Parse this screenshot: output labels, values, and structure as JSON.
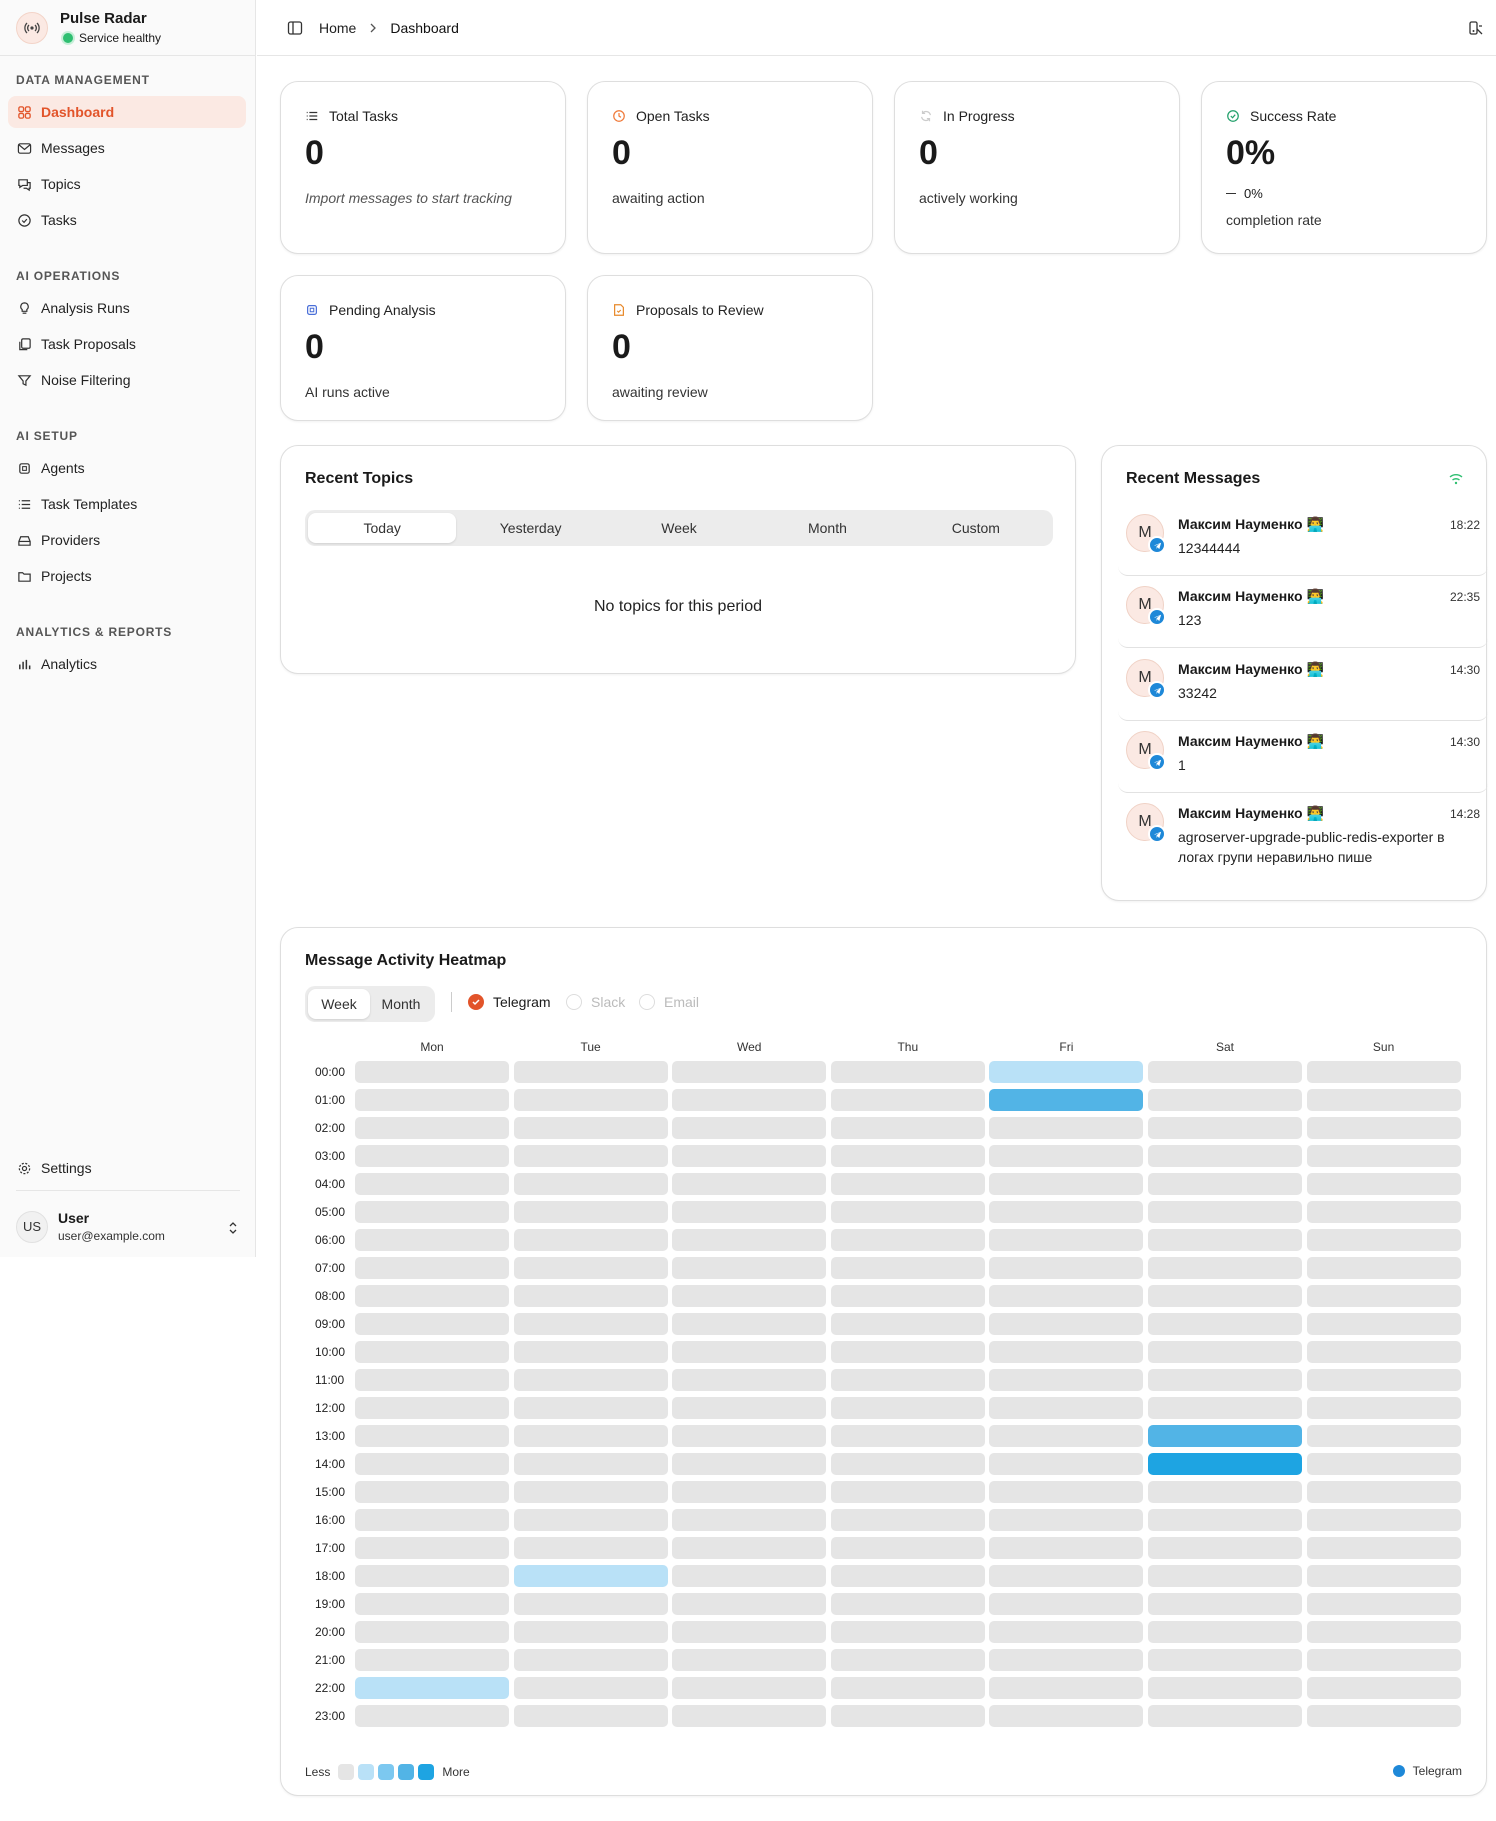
{
  "brand": {
    "name": "Pulse Radar",
    "status": "Service healthy"
  },
  "sidebar": {
    "sections": [
      {
        "label": "DATA MANAGEMENT",
        "items": [
          {
            "label": "Dashboard",
            "icon": "grid-icon"
          },
          {
            "label": "Messages",
            "icon": "mail-icon"
          },
          {
            "label": "Topics",
            "icon": "chat-icon"
          },
          {
            "label": "Tasks",
            "icon": "check-circle-icon"
          }
        ]
      },
      {
        "label": "AI OPERATIONS",
        "items": [
          {
            "label": "Analysis Runs",
            "icon": "bulb-icon"
          },
          {
            "label": "Task Proposals",
            "icon": "copy-icon"
          },
          {
            "label": "Noise Filtering",
            "icon": "filter-icon"
          }
        ]
      },
      {
        "label": "AI SETUP",
        "items": [
          {
            "label": "Agents",
            "icon": "chip-icon"
          },
          {
            "label": "Task Templates",
            "icon": "list-icon"
          },
          {
            "label": "Providers",
            "icon": "drive-icon"
          },
          {
            "label": "Projects",
            "icon": "folder-icon"
          }
        ]
      },
      {
        "label": "ANALYTICS & REPORTS",
        "items": [
          {
            "label": "Analytics",
            "icon": "bar-chart-icon"
          }
        ]
      }
    ],
    "settings": "Settings",
    "user": {
      "initials": "US",
      "name": "User",
      "email": "user@example.com"
    }
  },
  "breadcrumb": {
    "home": "Home",
    "current": "Dashboard"
  },
  "stats": [
    {
      "label": "Total Tasks",
      "value": "0",
      "sub": "Import messages to start tracking"
    },
    {
      "label": "Open Tasks",
      "value": "0",
      "sub": "awaiting action"
    },
    {
      "label": "In Progress",
      "value": "0",
      "sub": "actively working"
    },
    {
      "label": "Success Rate",
      "value": "0%",
      "trend": "0%",
      "sub": "completion rate"
    },
    {
      "label": "Pending Analysis",
      "value": "0",
      "sub": "AI runs active"
    },
    {
      "label": "Proposals to Review",
      "value": "0",
      "sub": "awaiting review"
    }
  ],
  "recent_topics": {
    "title": "Recent Topics",
    "tabs": [
      "Today",
      "Yesterday",
      "Week",
      "Month",
      "Custom"
    ],
    "empty": "No topics for this period"
  },
  "recent_messages": {
    "title": "Recent Messages",
    "items": [
      {
        "initial": "M",
        "name": "Максим Науменко 👨‍💻",
        "time": "18:22",
        "text": "12344444"
      },
      {
        "initial": "M",
        "name": "Максим Науменко 👨‍💻",
        "time": "22:35",
        "text": "123"
      },
      {
        "initial": "M",
        "name": "Максим Науменко 👨‍💻",
        "time": "14:30",
        "text": "33242"
      },
      {
        "initial": "M",
        "name": "Максим Науменко 👨‍💻",
        "time": "14:30",
        "text": "1"
      },
      {
        "initial": "M",
        "name": "Максим Науменко 👨‍💻",
        "time": "14:28",
        "text": "agroserver-upgrade-public-redis-exporter в логах групи неравильно пише"
      }
    ]
  },
  "heatmap": {
    "title": "Message Activity Heatmap",
    "views": [
      "Week",
      "Month"
    ],
    "sources": [
      "Telegram",
      "Slack",
      "Email"
    ],
    "days": [
      "Mon",
      "Tue",
      "Wed",
      "Thu",
      "Fri",
      "Sat",
      "Sun"
    ],
    "hours": [
      "00:00",
      "01:00",
      "02:00",
      "03:00",
      "04:00",
      "05:00",
      "06:00",
      "07:00",
      "08:00",
      "09:00",
      "10:00",
      "11:00",
      "12:00",
      "13:00",
      "14:00",
      "15:00",
      "16:00",
      "17:00",
      "18:00",
      "19:00",
      "20:00",
      "21:00",
      "22:00",
      "23:00"
    ],
    "active": [
      {
        "day": 4,
        "hour": 0,
        "level": 1
      },
      {
        "day": 4,
        "hour": 1,
        "level": 3
      },
      {
        "day": 5,
        "hour": 13,
        "level": 3
      },
      {
        "day": 5,
        "hour": 14,
        "level": 4
      },
      {
        "day": 1,
        "hour": 18,
        "level": 1
      },
      {
        "day": 0,
        "hour": 22,
        "level": 1
      }
    ],
    "levels": [
      "#e5e5e5",
      "#b9e1f7",
      "#7cc8f0",
      "#52b4e6",
      "#1ea4e2"
    ],
    "legend_less": "Less",
    "legend_more": "More",
    "legend_source": "Telegram"
  },
  "colors": {
    "accent": "#e2542a",
    "telegram": "#1e88d8"
  }
}
